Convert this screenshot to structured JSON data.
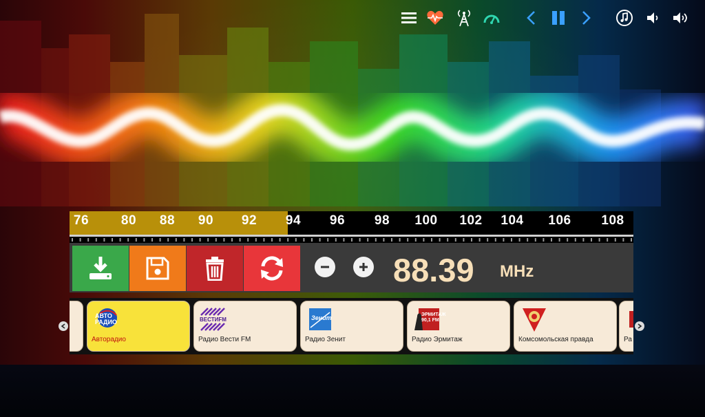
{
  "toolbar": {
    "icons": [
      "menu-icon",
      "heart-rate-icon",
      "radio-tower-icon",
      "gauge-icon",
      "chevron-left-icon",
      "pause-icon",
      "chevron-right-icon",
      "music-note-icon",
      "volume-down-icon",
      "volume-up-icon"
    ],
    "accent_color": "#3aa0ff",
    "heart_color": "#ff6a3a",
    "gauge_color": "#2fd6b0"
  },
  "scale": {
    "labels": [
      "76",
      "80",
      "88",
      "90",
      "92",
      "94",
      "96",
      "98",
      "100",
      "102",
      "104",
      "106",
      "108"
    ],
    "fill_color": "#b8900a",
    "fill_fraction": 0.387
  },
  "controls": {
    "download_color": "#3aa84a",
    "save_color": "#f07a1a",
    "delete_color": "#c0262a",
    "refresh_color": "#e8363a"
  },
  "tuner": {
    "frequency": "88.39",
    "unit": "MHz"
  },
  "presets": [
    {
      "name": "Авторадио",
      "logo_text": "АВТО РАДИО",
      "active": true
    },
    {
      "name": "Радио Вести FM",
      "logo_text": "ВЕСТИFM",
      "active": false
    },
    {
      "name": "Радио Зенит",
      "logo_text": "Зенит",
      "active": false
    },
    {
      "name": "Радио Эрмитаж",
      "logo_text": "ЭРМИТАЖ 90,1 FM",
      "active": false
    },
    {
      "name": "Комсомольская правда",
      "logo_text": "",
      "active": false
    },
    {
      "name": "Ра",
      "logo_text": "",
      "active": false
    }
  ]
}
